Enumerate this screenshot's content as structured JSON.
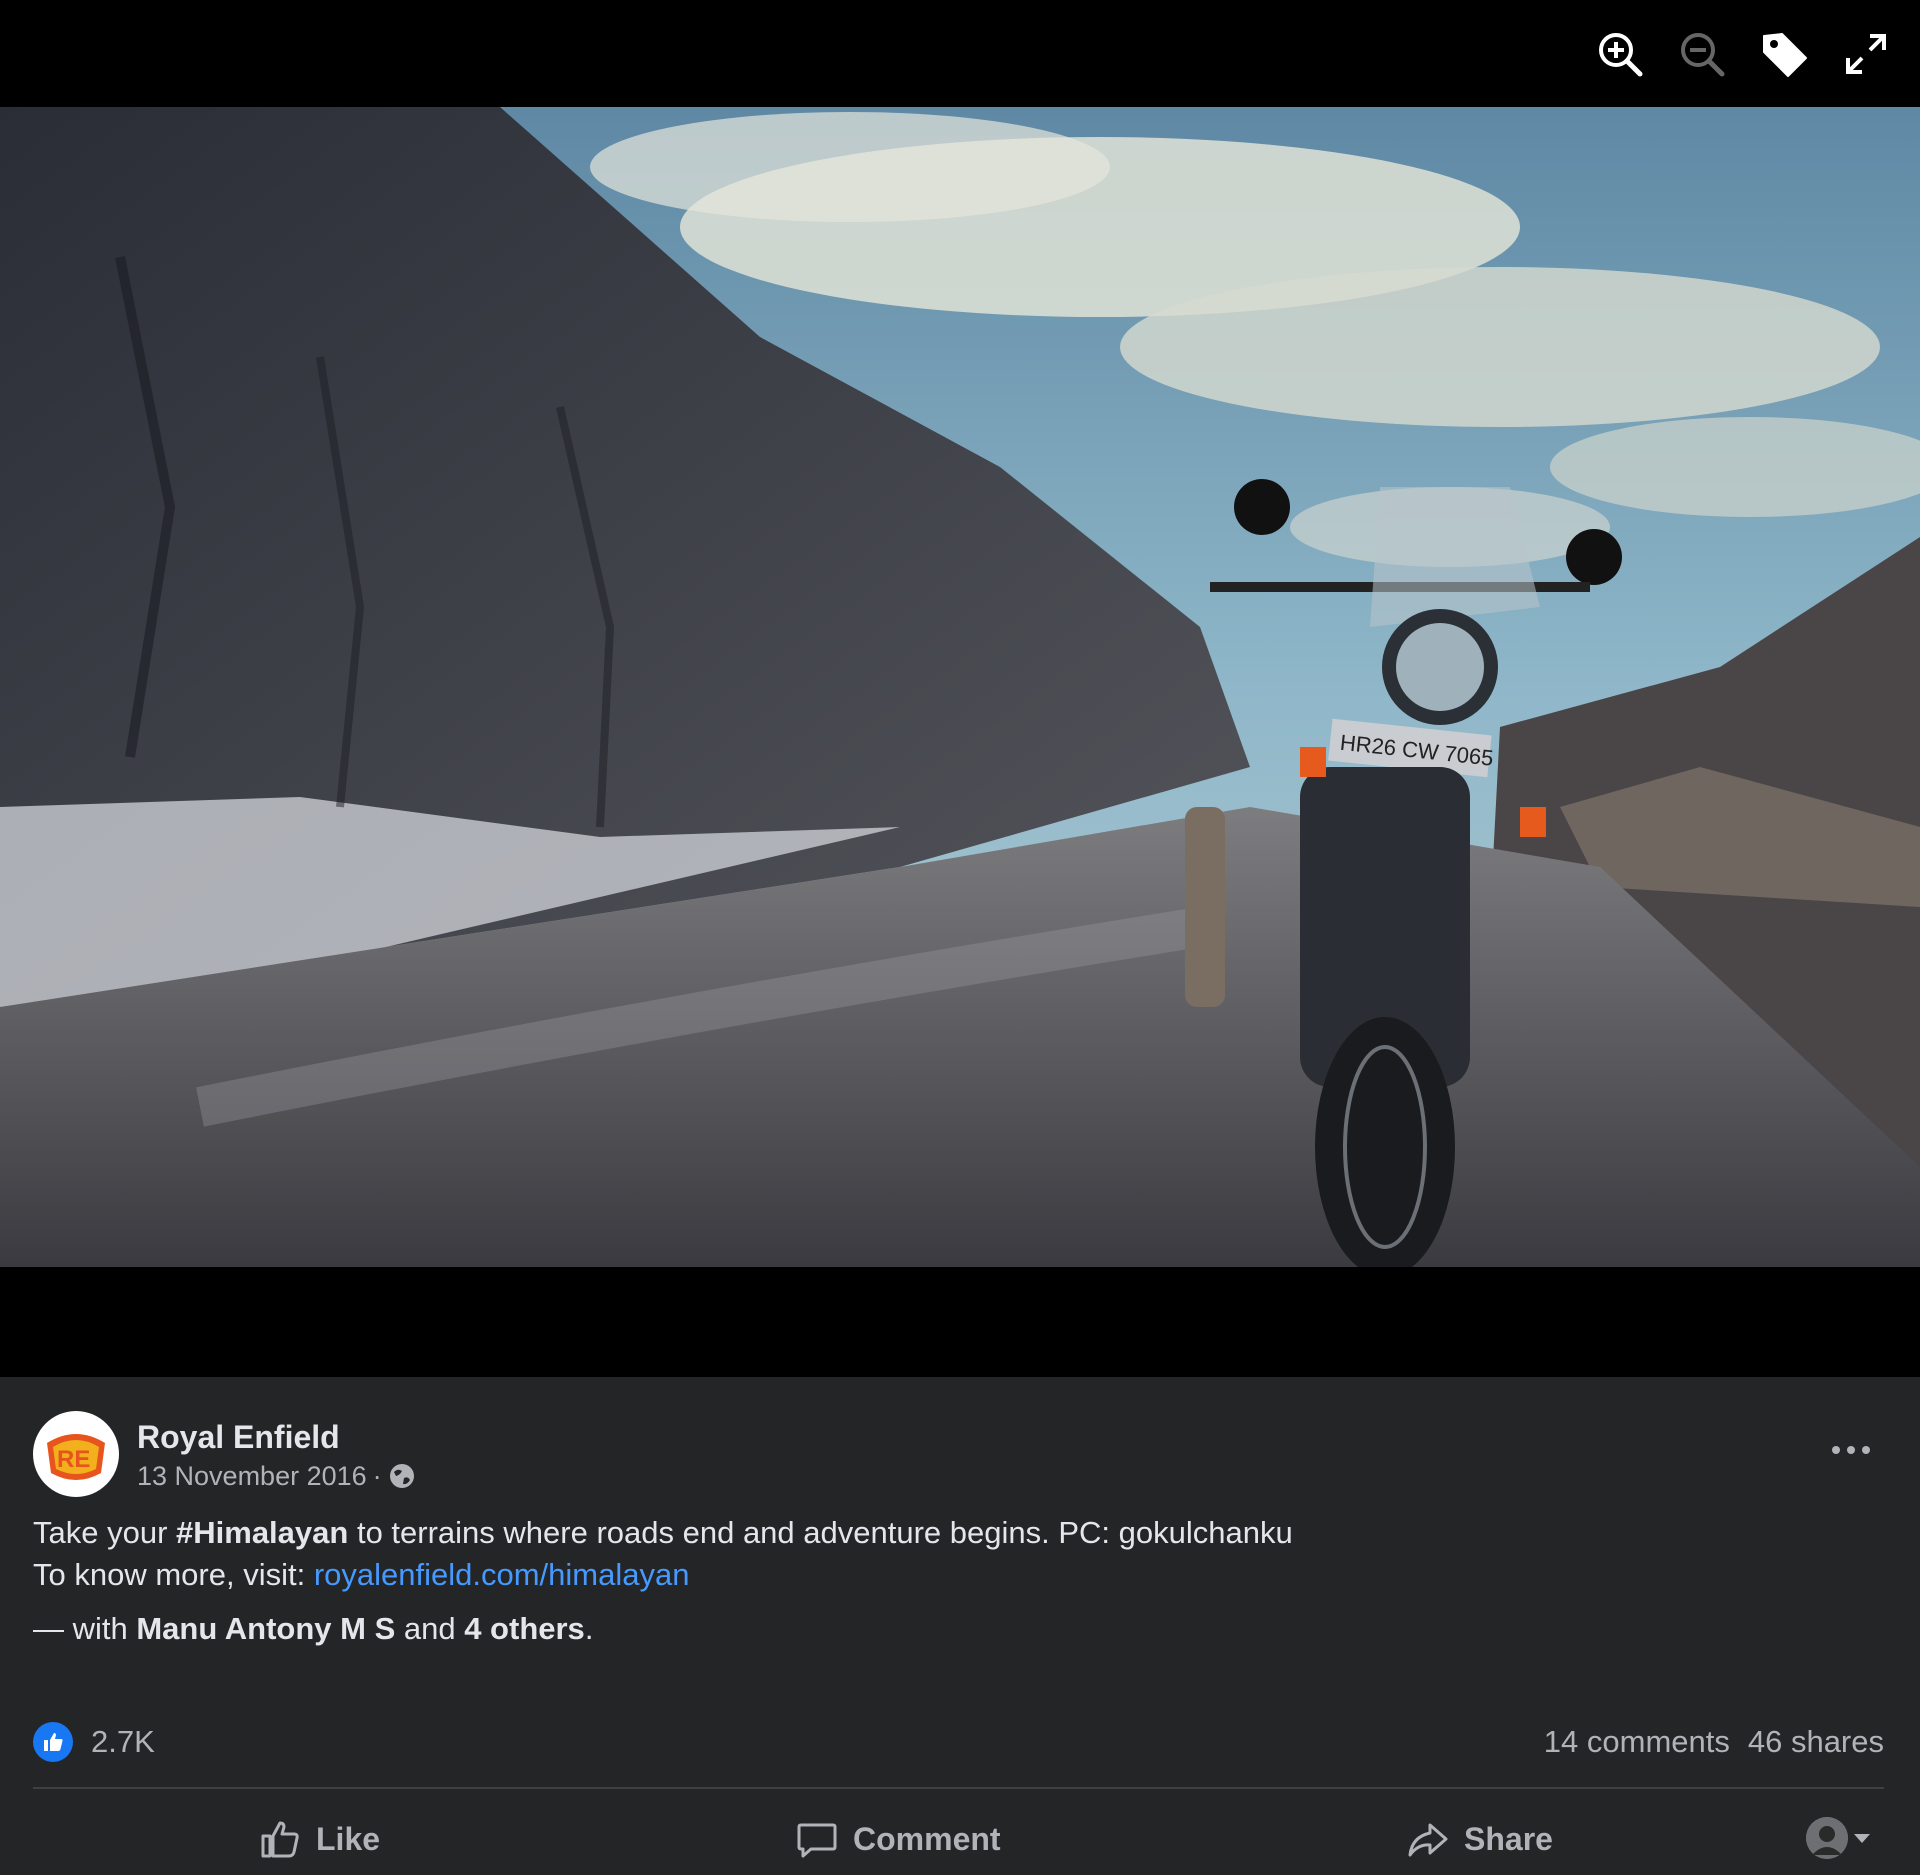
{
  "viewer": {
    "toolbar": {
      "zoom_in_icon": "zoom-in-icon",
      "zoom_out_icon": "zoom-out-icon",
      "tag_icon": "tag-icon",
      "fullscreen_icon": "expand-icon"
    },
    "photo": {
      "plate_text": "HR26 CW 7065"
    }
  },
  "post": {
    "page_name": "Royal Enfield",
    "date": "13 November 2016",
    "separator": "·",
    "caption": {
      "prefix": "Take your ",
      "hashtag": "#Himalayan",
      "suffix": " to terrains where roads end and adventure begins. PC: gokulchanku",
      "visit_text": "To know more, visit: ",
      "link": "royalenfield.com/himalayan",
      "with_prefix": "— with ",
      "with_name": "Manu Antony M S",
      "with_and": " and ",
      "with_others": "4 others",
      "with_end": "."
    },
    "stats": {
      "reactions": "2.7K",
      "comments": "14 comments",
      "shares": "46 shares"
    },
    "actions": {
      "like": "Like",
      "comment": "Comment",
      "share": "Share"
    }
  },
  "colors": {
    "panel_bg": "#242526",
    "text_primary": "#e4e6eb",
    "text_secondary": "#b0b3b8",
    "link": "#4599ff",
    "like_blue": "#1877f2"
  }
}
